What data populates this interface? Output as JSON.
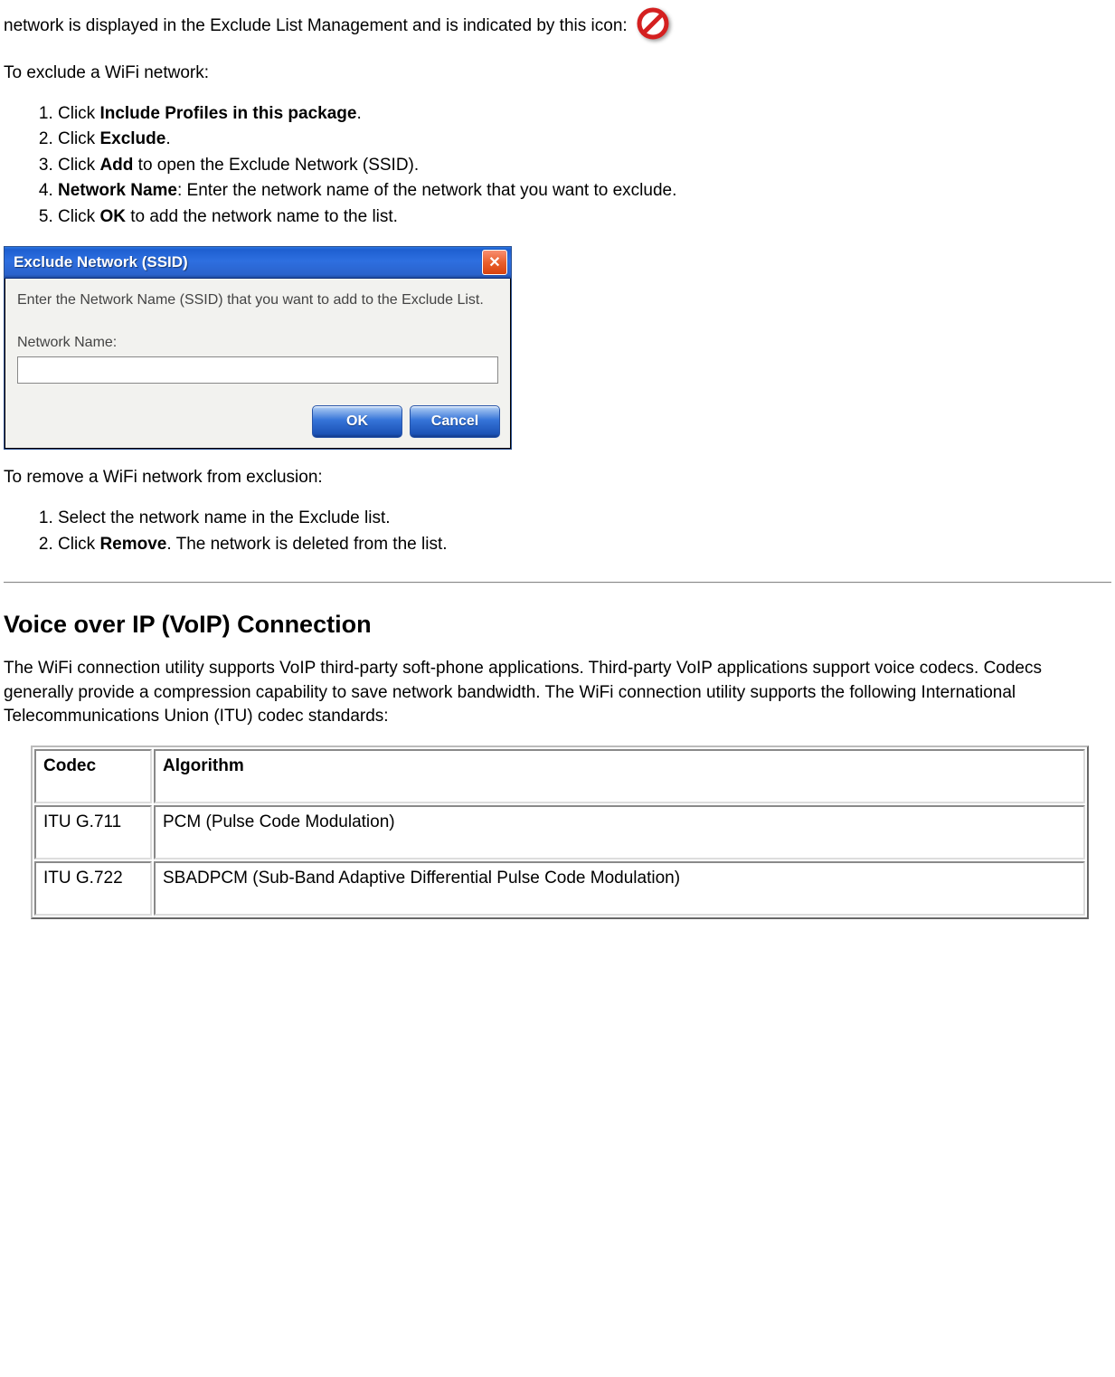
{
  "intro": {
    "line1": "network is displayed in the Exclude List Management and is indicated by this icon:"
  },
  "exclude": {
    "heading": "To exclude a WiFi network:",
    "steps": [
      {
        "pre": "Click ",
        "bold": "Include Profiles in this package",
        "post": "."
      },
      {
        "pre": "Click ",
        "bold": "Exclude",
        "post": "."
      },
      {
        "pre": "Click ",
        "bold": "Add",
        "post": " to open the Exclude Network (SSID)."
      },
      {
        "boldLead": "Network Name",
        "post": ": Enter the network name of the network that you want to exclude."
      },
      {
        "pre": "Click ",
        "bold": "OK",
        "post": " to add the network name to the list."
      }
    ]
  },
  "dialog": {
    "title": "Exclude Network (SSID)",
    "instruction": "Enter the Network Name (SSID) that you want to add to the Exclude List.",
    "label": "Network Name:",
    "input_value": "",
    "ok": "OK",
    "cancel": "Cancel",
    "close_glyph": "✕"
  },
  "remove": {
    "heading": "To remove a WiFi network from exclusion:",
    "steps": [
      "Select the network name in the Exclude list.",
      {
        "pre": "Click ",
        "bold": "Remove",
        "post": ". The network is deleted from the list."
      }
    ]
  },
  "voip": {
    "heading": "Voice over IP (VoIP) Connection",
    "paragraph": "The WiFi connection utility supports VoIP third-party soft-phone applications. Third-party VoIP applications support voice codecs. Codecs generally provide a compression capability to save network bandwidth. The WiFi connection utility supports the following International Telecommunications Union (ITU) codec standards:",
    "table": {
      "headers": [
        "Codec",
        "Algorithm"
      ],
      "rows": [
        {
          "codec": "ITU G.711",
          "algorithm": "PCM (Pulse Code Modulation)"
        },
        {
          "codec": "ITU G.722",
          "algorithm": "SBADPCM (Sub-Band Adaptive Differential Pulse Code Modulation)"
        }
      ]
    }
  }
}
